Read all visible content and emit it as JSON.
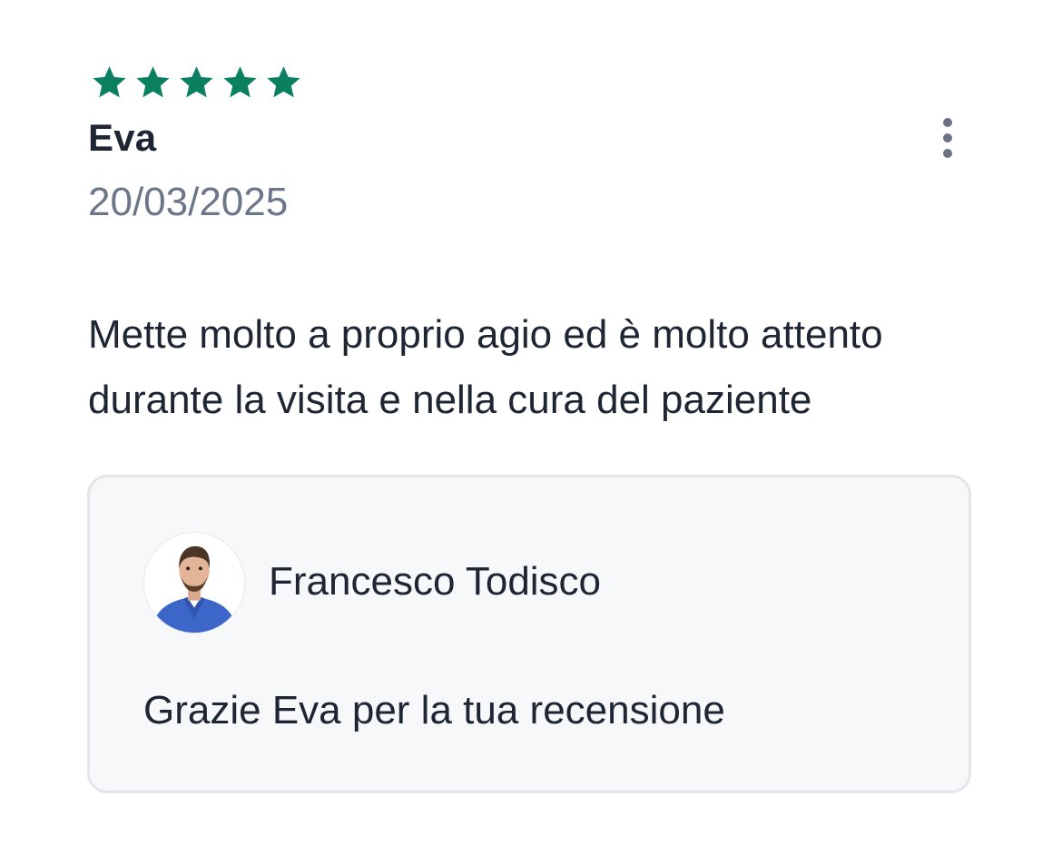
{
  "review": {
    "rating": 5,
    "rating_max": 5,
    "star_color": "#0b8060",
    "reviewer_name": "Eva",
    "date": "20/03/2025",
    "text": "Mette molto a proprio agio ed è molto attento durante la visita e nella cura del paziente",
    "menu_icon": "more-vertical-icon"
  },
  "reply": {
    "author": "Francesco Todisco",
    "text": "Grazie Eva per la tua recensione",
    "avatar_icon": "doctor-avatar"
  }
}
